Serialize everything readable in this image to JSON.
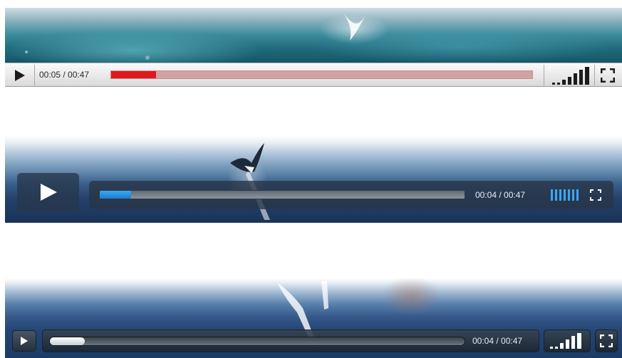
{
  "players": [
    {
      "skin": "light",
      "time_display": "00:05 / 00:47",
      "progress": 0.107,
      "volume_level": 5,
      "colors": {
        "progress_fill": "#e0191c",
        "progress_track": "#d2a2a2"
      },
      "icons": {
        "play": "play-icon",
        "volume": "volume-bars-icon",
        "fullscreen": "fullscreen-icon"
      }
    },
    {
      "skin": "dark-overlay",
      "time_display": "00:04 / 00:47",
      "progress": 0.085,
      "volume_level": 7,
      "colors": {
        "progress_fill": "#1a7fd0",
        "volume_bars": "#3aa6f0"
      },
      "icons": {
        "play": "big-play-icon",
        "volume": "volume-bars-icon",
        "fullscreen": "fullscreen-icon"
      }
    },
    {
      "skin": "glass-dark",
      "time_display": "00:04 / 00:47",
      "progress": 0.085,
      "volume_level": 5,
      "colors": {
        "progress_fill": "#ffffff"
      },
      "icons": {
        "play": "play-icon",
        "volume": "volume-bars-icon",
        "fullscreen": "fullscreen-icon"
      }
    }
  ]
}
